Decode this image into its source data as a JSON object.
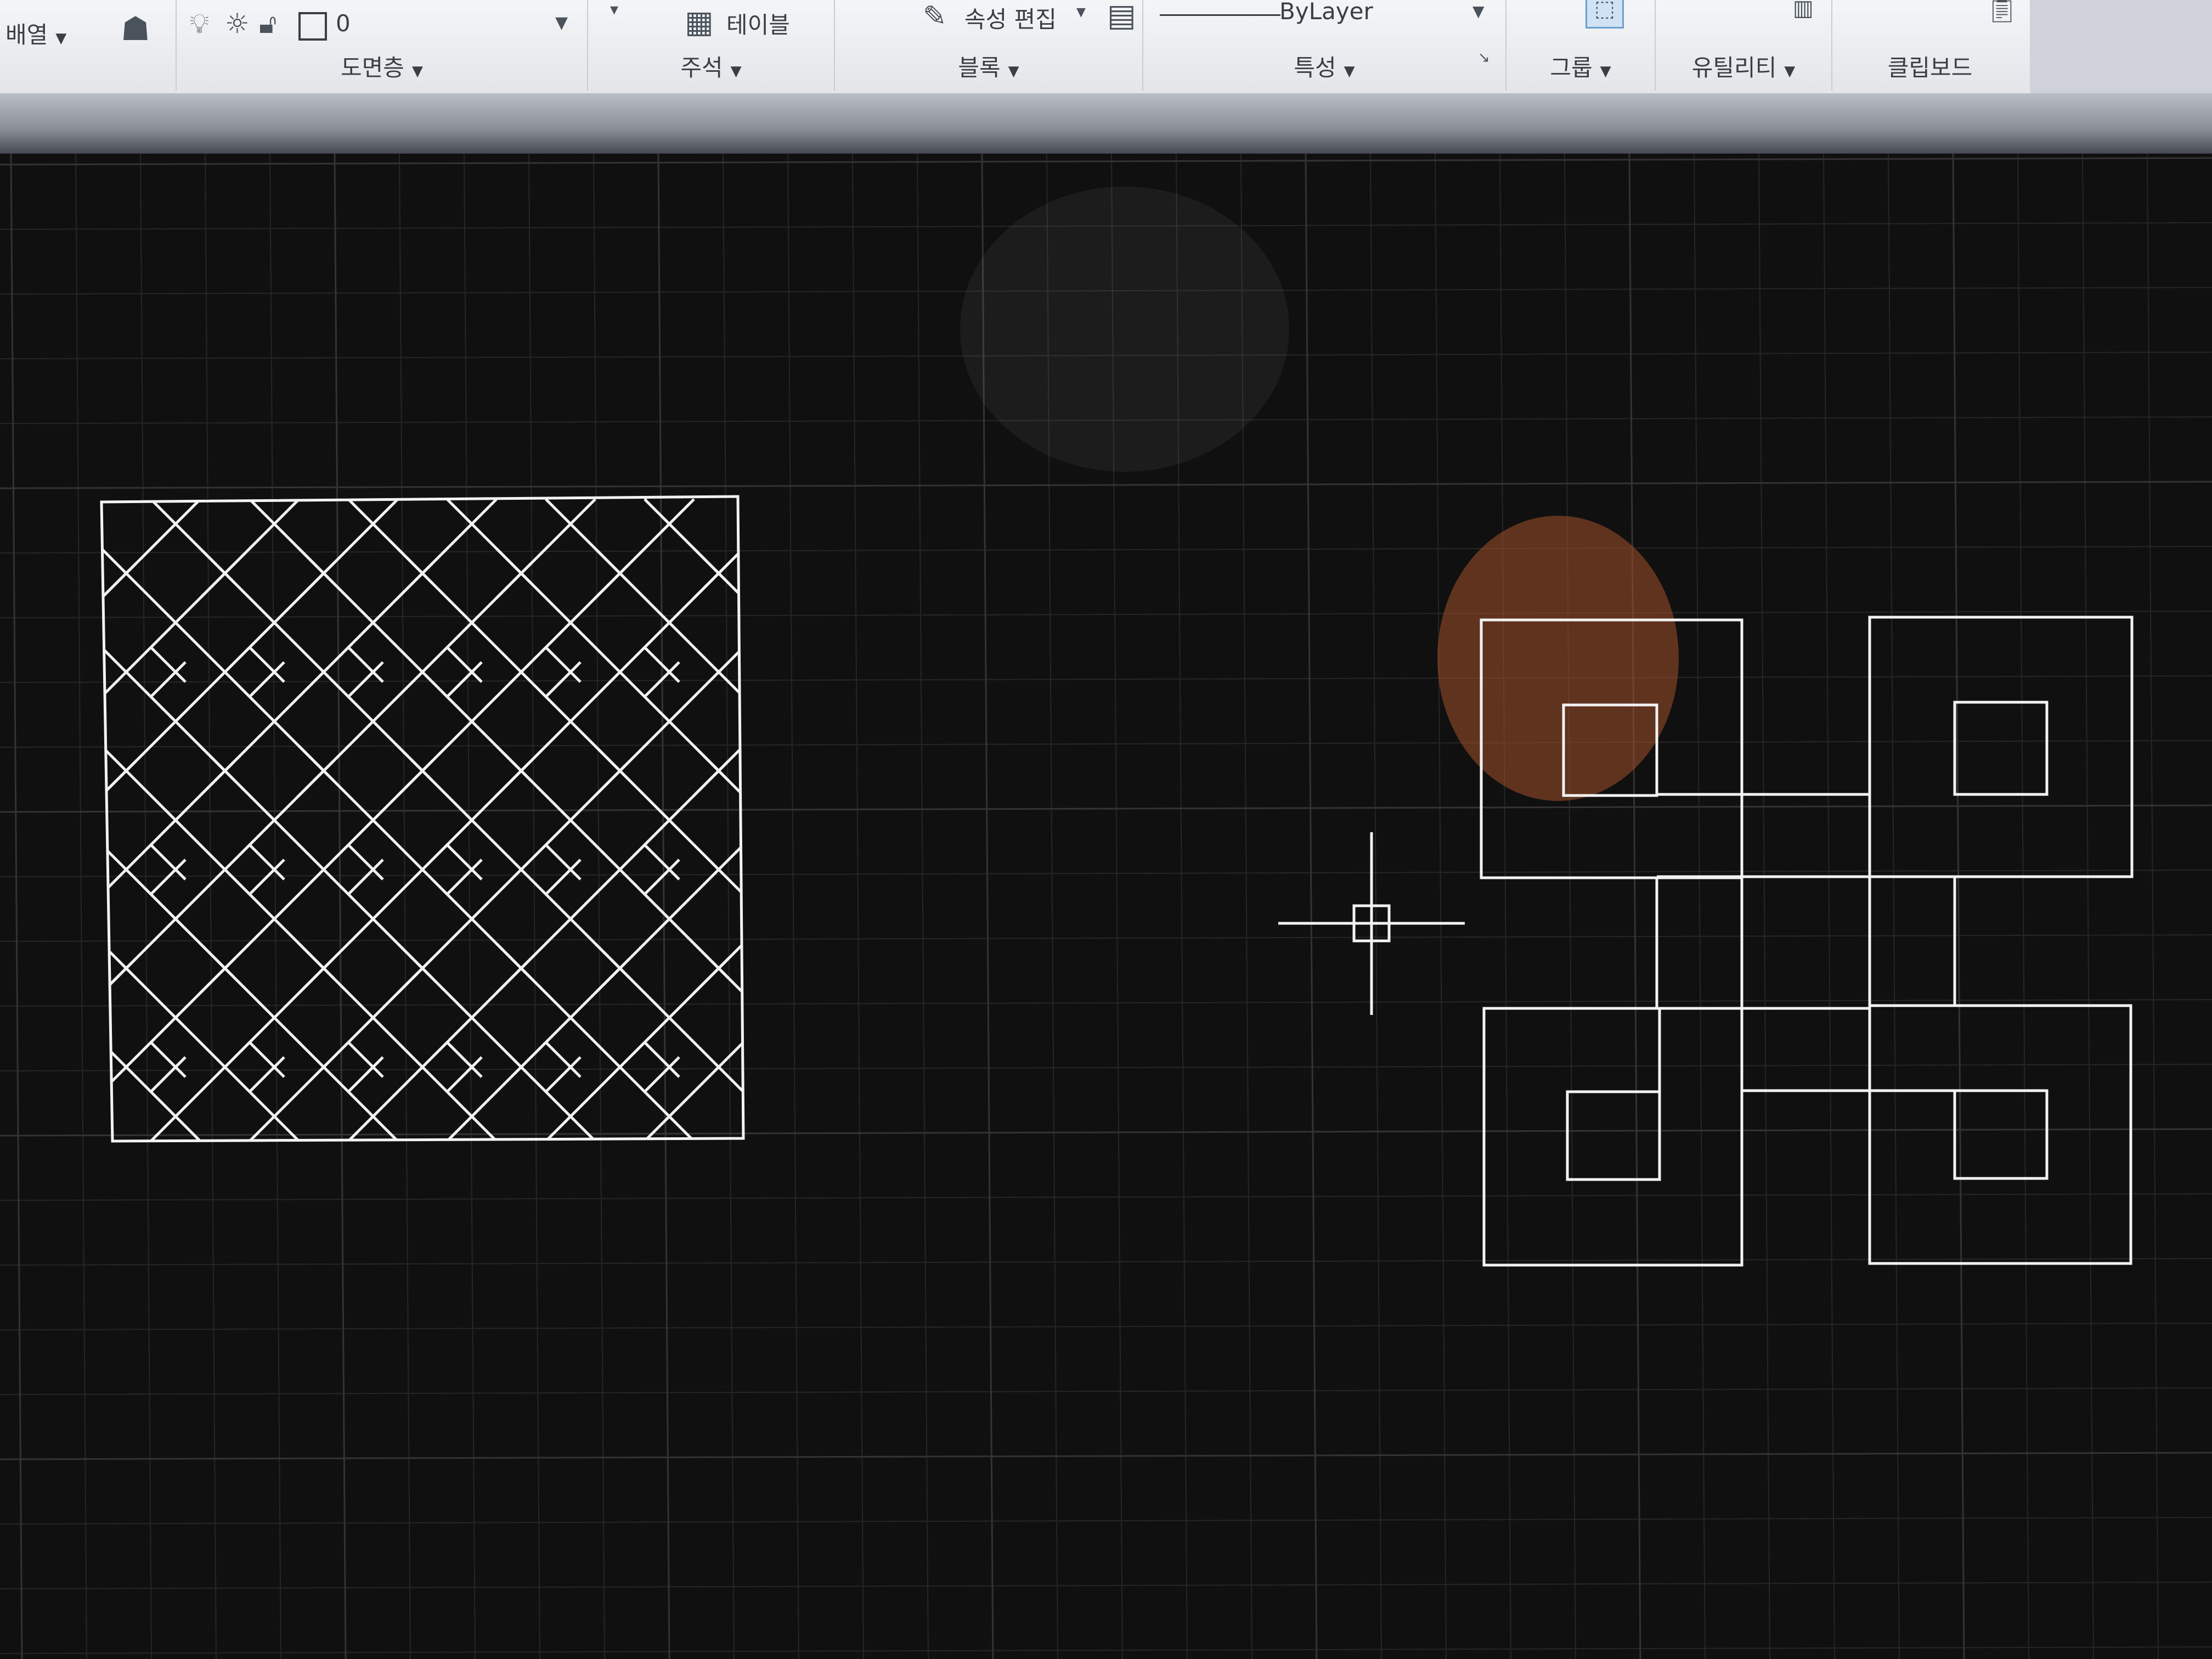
{
  "ribbon": {
    "array_label": "배열",
    "layer_panel_label": "도면층",
    "layer_current": "0",
    "annotation_panel_label": "주석",
    "table_label": "테이블",
    "block_panel_label": "블록",
    "edit_attributes_label": "속성 편집",
    "linetype_value": "ByLayer",
    "properties_panel_label": "특성",
    "group_panel_label": "그룹",
    "utilities_panel_label": "유틸리티",
    "clipboard_panel_label": "클립보드"
  },
  "icons": [
    "dropdown-caret-icon",
    "match-layer-icon",
    "lightbulb-icon",
    "sun-icon",
    "unlock-icon",
    "color-square-icon",
    "table-icon",
    "edit-attributes-icon",
    "linetype-icon",
    "group-select-icon",
    "calculator-icon",
    "paste-icon",
    "crosshair-cursor-icon"
  ],
  "colors": {
    "ribbon_bg": "#eceef1",
    "canvas_bg": "#111111",
    "grid_line": "#262626",
    "drawing_line": "#f2f2f2"
  }
}
